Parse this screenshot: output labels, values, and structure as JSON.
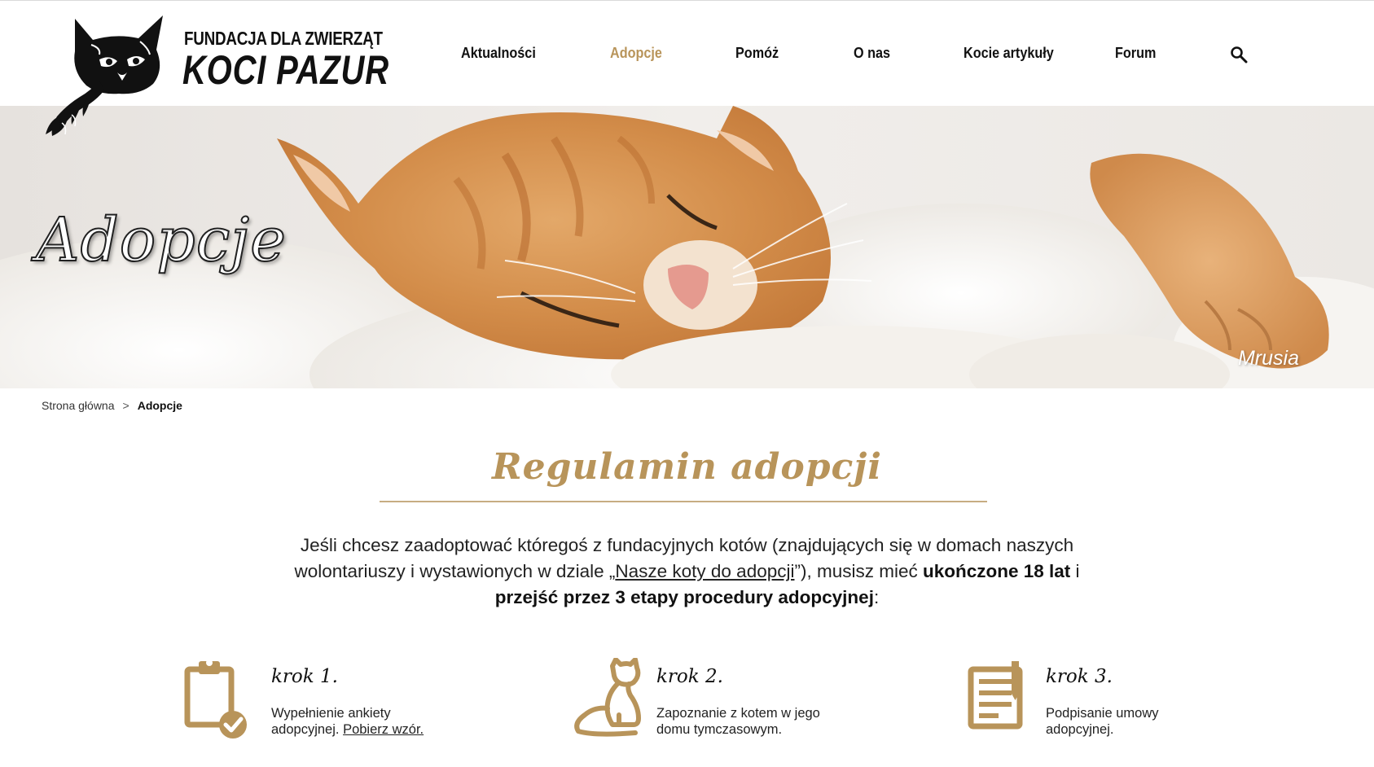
{
  "brand": {
    "line1": "FUNDACJA DLA ZWIERZĄT",
    "line2": "KOCI PAZUR"
  },
  "nav": {
    "items": [
      {
        "label": "Aktualności"
      },
      {
        "label": "Adopcje"
      },
      {
        "label": "Pomóż"
      },
      {
        "label": "O nas"
      },
      {
        "label": "Kocie artykuły"
      },
      {
        "label": "Forum"
      }
    ],
    "active": "Adopcje",
    "search_icon": "search-icon"
  },
  "hero": {
    "title": "Adopcje",
    "caption": "Mrusia"
  },
  "breadcrumb": {
    "home": "Strona główna",
    "separator": ">",
    "current": "Adopcje"
  },
  "content": {
    "title": "Regulamin adopcji",
    "intro": {
      "part1": "Jeśli chcesz zaadoptować któregoś z fundacyjnych kotów (znajdujących się w domach naszych wolontariuszy i wystawionych w dziale „",
      "link": "Nasze koty do adopcji",
      "part2": "”), musisz mieć ",
      "bold1": "ukończone 18 lat",
      "part3": " i ",
      "bold2": "przejść przez 3 etapy procedury adopcyjnej",
      "part4": ":"
    },
    "steps": [
      {
        "title": "krok 1.",
        "text": "Wypełnienie ankiety adopcyjnej.",
        "link": "Pobierz wzór.",
        "icon": "clipboard-check-icon"
      },
      {
        "title": "krok 2.",
        "text": "Zapoznanie z kotem w jego domu tymczasowym.",
        "icon": "sitting-cat-icon"
      },
      {
        "title": "krok 3.",
        "text": "Podpisanie umowy adopcyjnej.",
        "icon": "contract-document-icon"
      }
    ]
  },
  "colors": {
    "accent": "#b8945a",
    "text": "#222222",
    "background": "#ffffff"
  }
}
